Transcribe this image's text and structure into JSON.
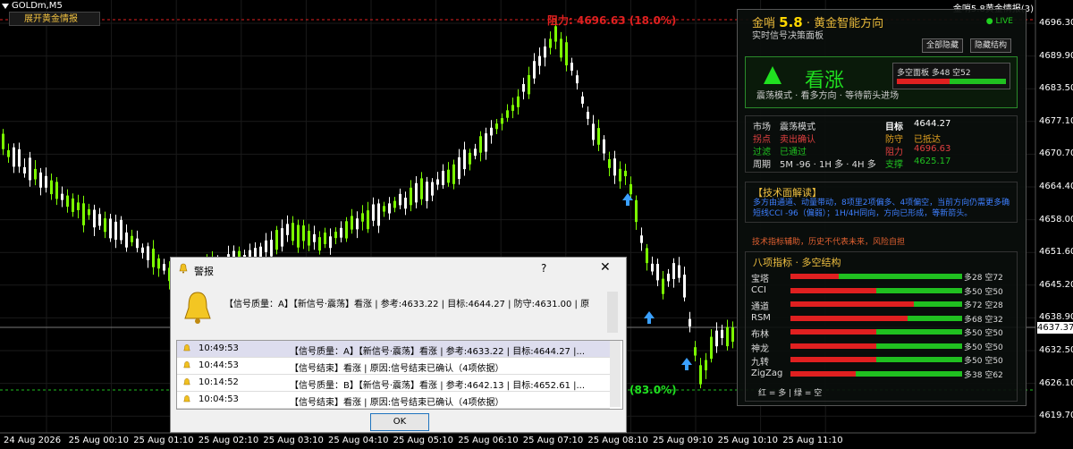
{
  "header": {
    "symbol": "GOLDm,M5",
    "expand_button": "展开黄金情报",
    "top_right": "金哨5.8黄金情报(3)"
  },
  "chart": {
    "price_labels": [
      "4696.30",
      "4689.90",
      "4683.50",
      "4677.10",
      "4670.70",
      "4664.40",
      "4658.00",
      "4651.60",
      "4645.20",
      "4638.90",
      "4632.50",
      "4626.10",
      "4619.70"
    ],
    "current_price": "4637.37",
    "time_labels": [
      "24 Aug 2026",
      "25 Aug 00:10",
      "25 Aug 01:10",
      "25 Aug 02:10",
      "25 Aug 03:10",
      "25 Aug 04:10",
      "25 Aug 05:10",
      "25 Aug 06:10",
      "25 Aug 07:10",
      "25 Aug 08:10",
      "25 Aug 09:10",
      "25 Aug 10:10",
      "25 Aug 11:10"
    ],
    "resistance_label": "阻力: 4696.63 (18.0%)",
    "support_label": "(83.0%)",
    "colors": {
      "bull": "#7cfc00",
      "bear": "#ffffff",
      "resistance": "#e02020",
      "support": "#20c020"
    }
  },
  "panel": {
    "title_prefix": "金哨 ",
    "title_version": "5.8",
    "title_suffix": " · 黄金智能方向",
    "live": "● LIVE",
    "subtitle": "实时信号决策面板",
    "btn_hide_all": "全部隐藏",
    "btn_hide_struct": "隐藏结构",
    "signal": "看涨",
    "signal_desc": "震荡模式 · 看多方向 · 等待箭头进场",
    "balance_label": "多空面板  多48 空52",
    "balance_long_pct": 48,
    "info": {
      "market_k": "市场",
      "market_v": "震荡模式",
      "target_k": "目标",
      "target_v": "4644.27",
      "turn_k": "拐点",
      "turn_v": "卖出确认",
      "guard_k": "防守",
      "guard_v": "已抵达",
      "filter_k": "过滤",
      "filter_v": "已通过",
      "resist_k": "阻力",
      "resist_v": "4696.63",
      "cycle_k": "周期",
      "cycle_v": "5M -96 · 1H 多 · 4H 多",
      "support_k": "支撑",
      "support_v": "4625.17"
    },
    "tech_header": "【技术面解读】",
    "tech_text": "多方由通道、动量带动，8项里2项偏多、4项偏空，当前方向仍需更多确 短线CCI -96（偏弱）；1H/4H同向，方向已形成，等新箭头。",
    "warning": "技术指标辅助，历史不代表未来，风险自担",
    "ind_header": "八项指标 · 多空结构",
    "indicators": [
      {
        "name": "宝塔",
        "long": 28,
        "label": "多28 空72"
      },
      {
        "name": "CCI",
        "long": 50,
        "label": "多50 空50"
      },
      {
        "name": "通道",
        "long": 72,
        "label": "多72 空28"
      },
      {
        "name": "RSM",
        "long": 68,
        "label": "多68 空32"
      },
      {
        "name": "布林",
        "long": 50,
        "label": "多50 空50"
      },
      {
        "name": "神龙",
        "long": 50,
        "label": "多50 空50"
      },
      {
        "name": "九转",
        "long": 50,
        "label": "多50 空50"
      },
      {
        "name": "ZigZag",
        "long": 38,
        "label": "多38 空62"
      }
    ],
    "ind_footer": "红 = 多  |  绿 = 空"
  },
  "dialog": {
    "title": "警报",
    "help": "?",
    "close": "✕",
    "message": "【信号质量：A】【新信号·震荡】看涨 | 参考:4633.22 | 目标:4644.27 | 防守:4631.00 | 原",
    "rows": [
      {
        "time": "10:49:53",
        "msg": "【信号质量：A】【新信号·震荡】看涨 | 参考:4633.22 | 目标:4644.27 |..."
      },
      {
        "time": "10:44:53",
        "msg": "【信号结束】看涨 | 原因:信号结束已确认（4项依据）"
      },
      {
        "time": "10:14:52",
        "msg": "【信号质量：B】【新信号·震荡】看涨 | 参考:4642.13 | 目标:4652.61 |..."
      },
      {
        "time": "10:04:53",
        "msg": "【信号结束】看涨 | 原因:信号结束已确认（4项依据）"
      }
    ],
    "ok": "OK"
  }
}
